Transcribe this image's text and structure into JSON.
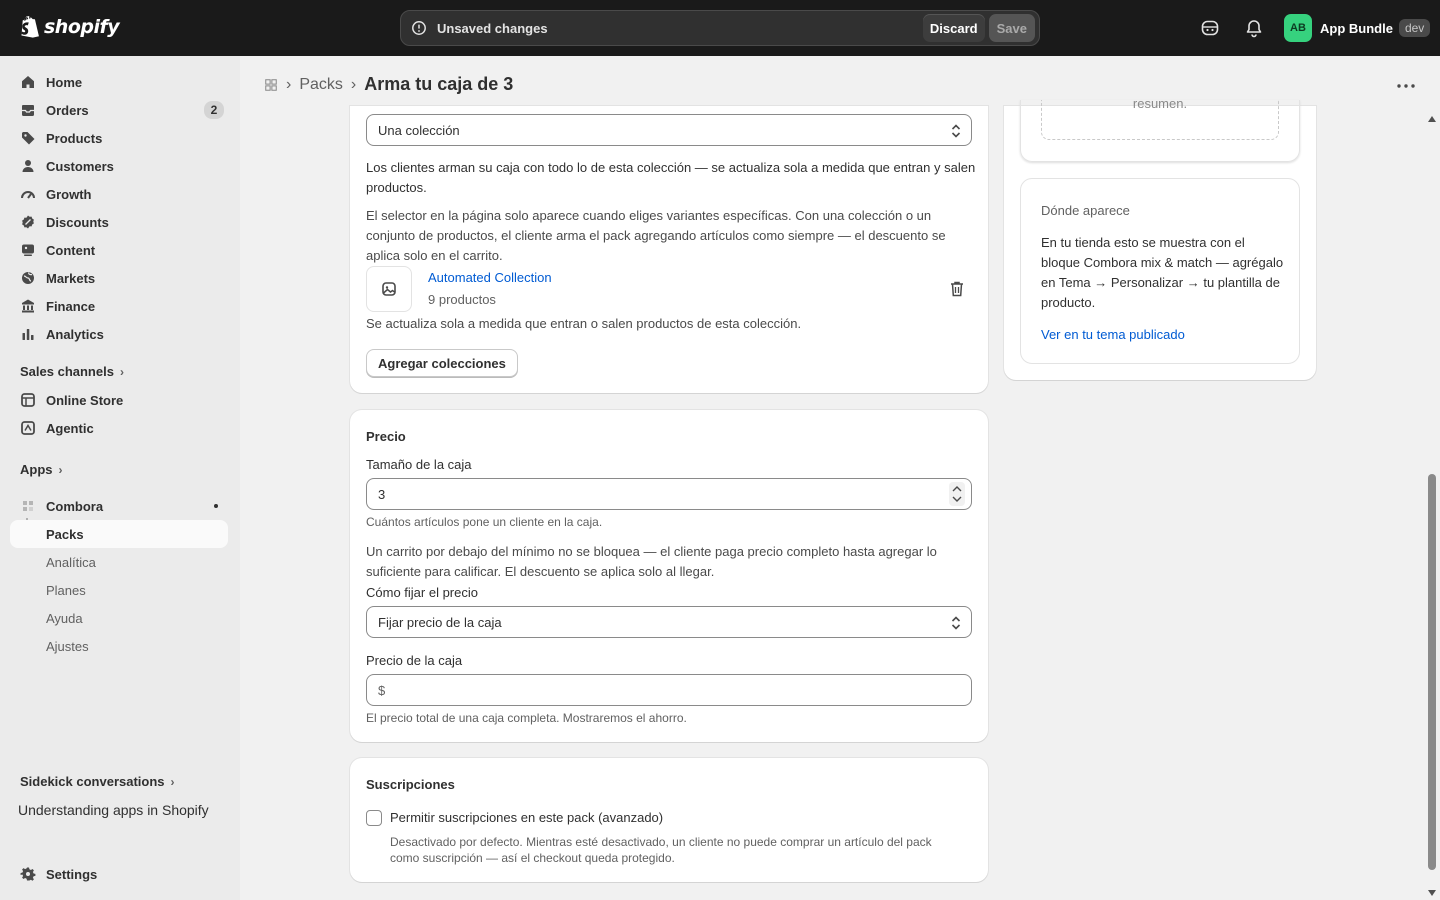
{
  "topbar": {
    "logo_text": "shopify",
    "unsaved_text": "Unsaved changes",
    "discard_label": "Discard",
    "save_label": "Save",
    "avatar_initials": "AB",
    "store_name": "App Bundle",
    "store_badge": "dev"
  },
  "sidebar": {
    "items": [
      {
        "label": "Home",
        "icon": "home-icon"
      },
      {
        "label": "Orders",
        "icon": "orders-icon",
        "badge": "2"
      },
      {
        "label": "Products",
        "icon": "tag-icon"
      },
      {
        "label": "Customers",
        "icon": "person-icon"
      },
      {
        "label": "Growth",
        "icon": "gauge-icon"
      },
      {
        "label": "Discounts",
        "icon": "discount-icon"
      },
      {
        "label": "Content",
        "icon": "content-icon"
      },
      {
        "label": "Markets",
        "icon": "globe-icon"
      },
      {
        "label": "Finance",
        "icon": "bank-icon"
      },
      {
        "label": "Analytics",
        "icon": "bar-chart-icon"
      }
    ],
    "sales_channels_label": "Sales channels",
    "channels": [
      {
        "label": "Online Store",
        "icon": "store-icon"
      },
      {
        "label": "Agentic",
        "icon": "agentic-icon"
      }
    ],
    "apps_label": "Apps",
    "app_name": "Combora",
    "app_subitems": [
      "Packs",
      "Analítica",
      "Planes",
      "Ayuda",
      "Ajustes"
    ],
    "sidekick_label": "Sidekick conversations",
    "sidekick_item": "Understanding apps in Shopify",
    "settings_label": "Settings"
  },
  "header": {
    "crumb": "Packs",
    "title": "Arma tu caja de 3"
  },
  "products_card": {
    "source_select": "Una colección",
    "desc1": "Los clientes arman su caja con todo lo de esta colección — se actualiza sola a medida que entran y salen productos.",
    "desc2": "El selector en la página solo aparece cuando eliges variantes específicas. Con una colección o un conjunto de productos, el cliente arma el pack agregando artículos como siempre — el descuento se aplica solo en el carrito.",
    "collection_name": "Automated Collection",
    "collection_count": "9 productos",
    "collection_note": "Se actualiza sola a medida que entran o salen productos de esta colección.",
    "add_button": "Agregar colecciones"
  },
  "price_card": {
    "title": "Precio",
    "size_label": "Tamaño de la caja",
    "size_value": "3",
    "size_help": "Cuántos artículos pone un cliente en la caja.",
    "min_note": "Un carrito por debajo del mínimo no se bloquea — el cliente paga precio completo hasta agregar lo suficiente para calificar. El descuento se aplica solo al llegar.",
    "pricing_label": "Cómo fijar el precio",
    "pricing_select": "Fijar precio de la caja",
    "box_price_label": "Precio de la caja",
    "currency": "$",
    "box_price_help": "El precio total de una caja completa. Mostraremos el ahorro."
  },
  "subs_card": {
    "title": "Suscripciones",
    "checkbox_label": "Permitir suscripciones en este pack (avanzado)",
    "checkbox_help": "Desactivado por defecto. Mientras esté desactivado, un cliente no puede comprar un artículo del pack como suscripción — así el checkout queda protegido."
  },
  "side_card": {
    "cut_text": "resumen.",
    "title": "Dónde aparece",
    "body": "En tu tienda esto se muestra con el bloque Combora mix & match — agrégalo en Tema → Personalizar → tu plantilla de producto.",
    "link": "Ver en tu tema publicado"
  }
}
